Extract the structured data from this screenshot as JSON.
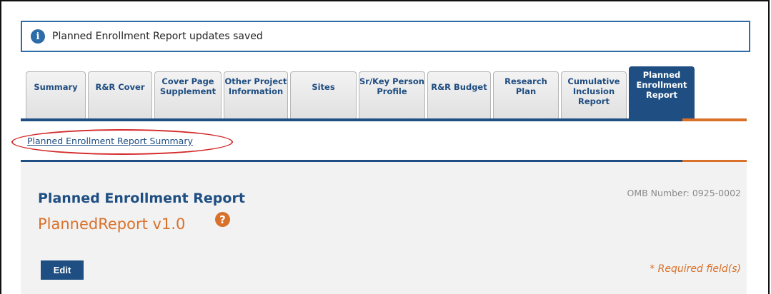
{
  "alert": {
    "icon": "info-icon",
    "message": "Planned Enrollment Report updates saved"
  },
  "tabs": [
    {
      "label": "Summary"
    },
    {
      "label": "R&R Cover"
    },
    {
      "label": "Cover Page Supplement"
    },
    {
      "label": "Other Project Information"
    },
    {
      "label": "Sites"
    },
    {
      "label": "Sr/Key Person Profile"
    },
    {
      "label": "R&R Budget"
    },
    {
      "label": "Research Plan"
    },
    {
      "label": "Cumulative Inclusion Report"
    },
    {
      "label": "Planned Enrollment Report",
      "active": true
    }
  ],
  "sublink": {
    "label": "Planned Enrollment Report Summary"
  },
  "form": {
    "title": "Planned Enrollment Report",
    "name": "PlannedReport v1.0",
    "help_icon": "?",
    "omb": "OMB Number: 0925-0002",
    "edit_label": "Edit",
    "required_note": "* Required field(s)"
  },
  "colors": {
    "primary": "#1f4f82",
    "accent": "#d9712a",
    "annotation": "#d42a2a"
  }
}
